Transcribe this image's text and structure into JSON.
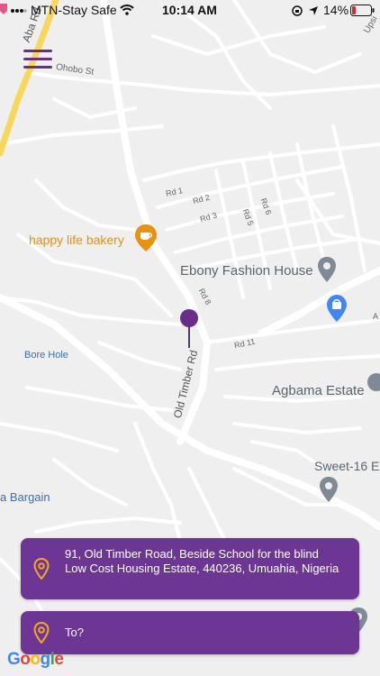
{
  "status_bar": {
    "carrier": "MTN-Stay Safe",
    "time": "10:14 AM",
    "battery": "14%"
  },
  "map": {
    "labels": {
      "aba_rd": "Aba Rd",
      "ohobo_st": "Ohobo St",
      "upsi": "Upsi",
      "rd1": "Rd 1",
      "rd2": "Rd 2",
      "rd3": "Rd 3",
      "rd5": "Rd 5",
      "rd6": "Rd 6",
      "rd8": "Rd 8",
      "rd11": "Rd 11",
      "old_timber_rd": "Old Timber Rd",
      "bore_hole": "Bore Hole",
      "bargain": "a Bargain",
      "sweet16": "Sweet-16 E",
      "a_edge": "A"
    },
    "places": {
      "bakery": "happy life bakery",
      "ebony": "Ebony Fashion House",
      "agbama": "Agbama Estate"
    },
    "colors": {
      "pin": "#6b2e86",
      "bakery": "#e8920f",
      "road_major": "#f7d85a",
      "place_label": "#5a6470",
      "shop_icon": "#4285f4"
    }
  },
  "from_card": {
    "address": "91, Old Timber Road, Beside School for the blind Low Cost Housing Estate, 440236, Umuahia, Nigeria"
  },
  "to_card": {
    "placeholder": "To?"
  },
  "google": {
    "letters": [
      "G",
      "o",
      "o",
      "g",
      "l",
      "e"
    ]
  }
}
